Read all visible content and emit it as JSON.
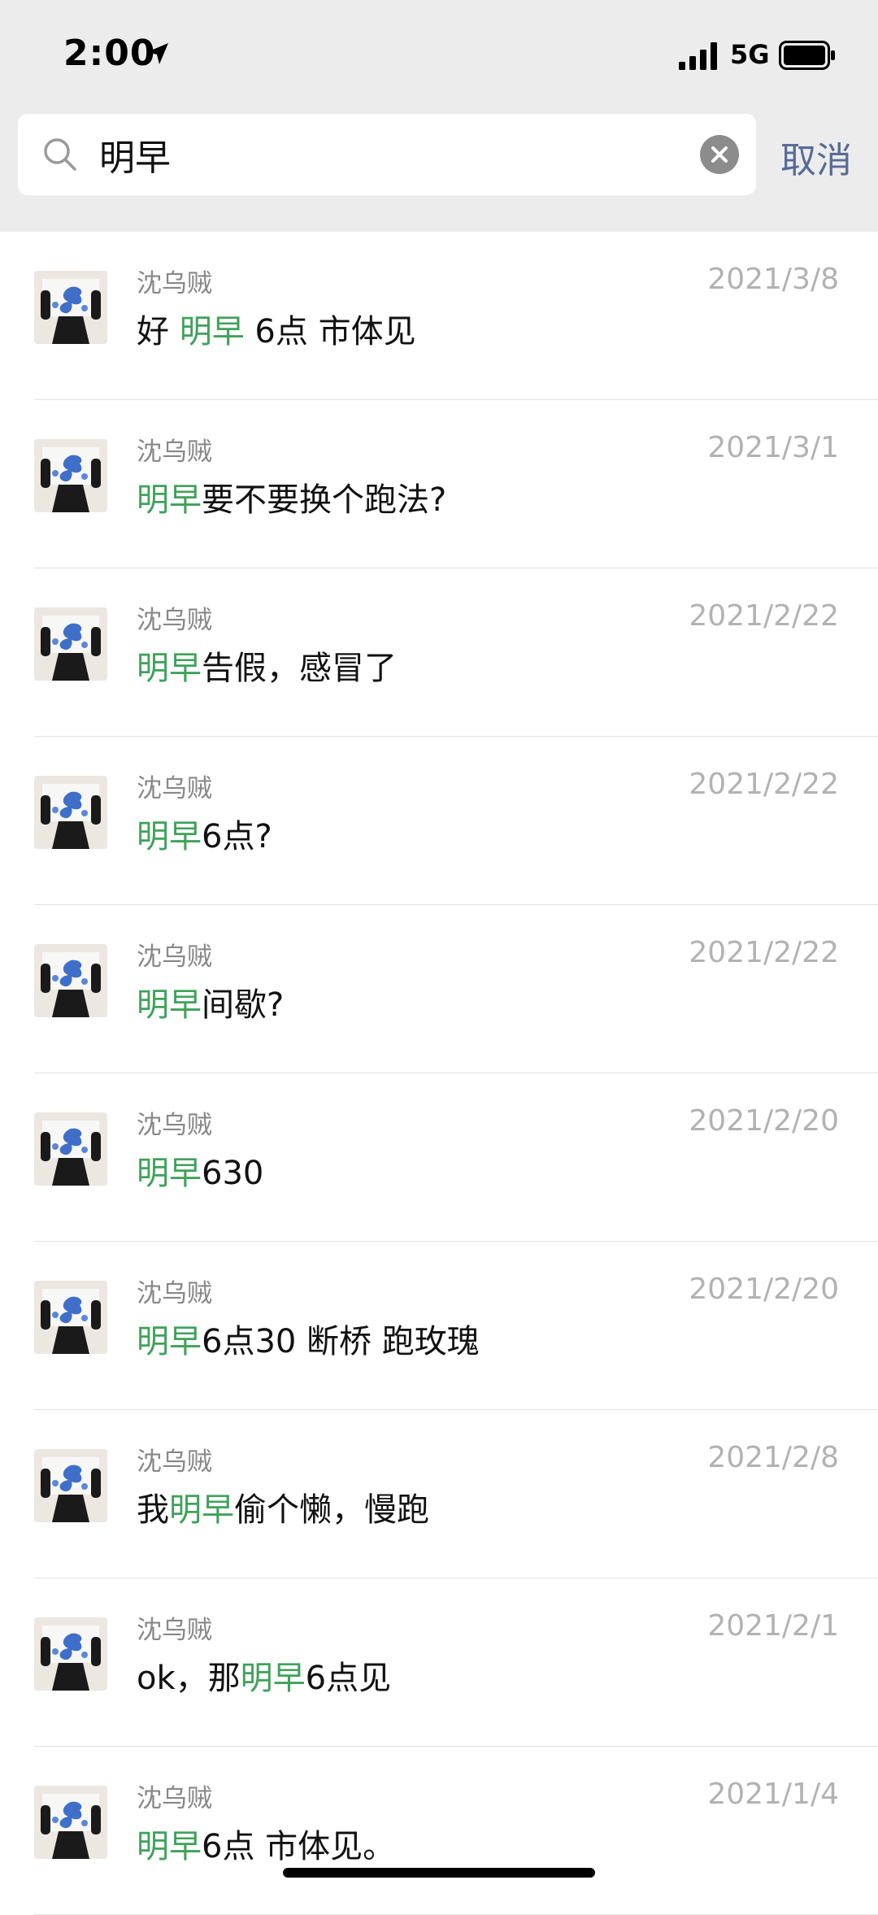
{
  "status_bar": {
    "time": "2:00",
    "network": "5G"
  },
  "search": {
    "query": "明早",
    "cancel_label": "取消"
  },
  "highlight_color": "#3fa25a",
  "results": [
    {
      "sender": "沈乌贼",
      "date": "2021/3/8",
      "before": "好 ",
      "keyword": "明早",
      "after": " 6点 市体见"
    },
    {
      "sender": "沈乌贼",
      "date": "2021/3/1",
      "before": "",
      "keyword": "明早",
      "after": "要不要换个跑法?"
    },
    {
      "sender": "沈乌贼",
      "date": "2021/2/22",
      "before": "",
      "keyword": "明早",
      "after": "告假，感冒了"
    },
    {
      "sender": "沈乌贼",
      "date": "2021/2/22",
      "before": "",
      "keyword": "明早",
      "after": "6点?"
    },
    {
      "sender": "沈乌贼",
      "date": "2021/2/22",
      "before": "",
      "keyword": "明早",
      "after": "间歇?"
    },
    {
      "sender": "沈乌贼",
      "date": "2021/2/20",
      "before": "",
      "keyword": "明早",
      "after": "630"
    },
    {
      "sender": "沈乌贼",
      "date": "2021/2/20",
      "before": "",
      "keyword": "明早",
      "after": "6点30 断桥 跑玫瑰"
    },
    {
      "sender": "沈乌贼",
      "date": "2021/2/8",
      "before": "我",
      "keyword": "明早",
      "after": "偷个懒，慢跑"
    },
    {
      "sender": "沈乌贼",
      "date": "2021/2/1",
      "before": "ok，那",
      "keyword": "明早",
      "after": "6点见"
    },
    {
      "sender": "沈乌贼",
      "date": "2021/1/4",
      "before": "",
      "keyword": "明早",
      "after": "6点 市体见。"
    }
  ]
}
